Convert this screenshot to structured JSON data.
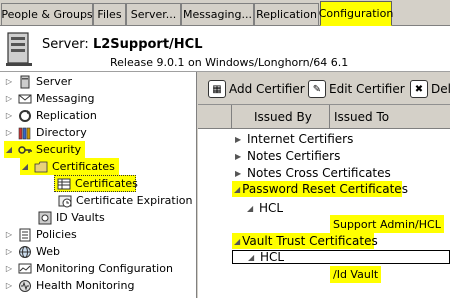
{
  "tabs": [
    {
      "label": "People & Groups",
      "active": false
    },
    {
      "label": "Files",
      "active": false
    },
    {
      "label": "Server...",
      "active": false
    },
    {
      "label": "Messaging...",
      "active": false
    },
    {
      "label": "Replication",
      "active": false
    },
    {
      "label": "Configuration",
      "active": true
    }
  ],
  "header": {
    "server_prefix": "Server:",
    "server_name": "L2Support/HCL",
    "release": "Release 9.0.1 on Windows/Longhorn/64 6.1"
  },
  "tree": {
    "items": [
      {
        "label": "Server",
        "icon": "server-icon",
        "expanded": false
      },
      {
        "label": "Messaging",
        "icon": "messaging-icon",
        "expanded": false
      },
      {
        "label": "Replication",
        "icon": "replication-icon",
        "expanded": false
      },
      {
        "label": "Directory",
        "icon": "directory-icon",
        "expanded": false
      },
      {
        "label": "Security",
        "icon": "key-icon",
        "expanded": true,
        "highlighted": true
      },
      {
        "label": "Certificates",
        "icon": "certificate-folder-icon",
        "expanded": true,
        "highlighted": true
      },
      {
        "label": "Certificates",
        "icon": "certificate-view-icon",
        "selected": true,
        "highlighted": true
      },
      {
        "label": "Certificate Expiration",
        "icon": "certificate-expiration-icon"
      },
      {
        "label": "ID Vaults",
        "icon": "id-vault-icon"
      },
      {
        "label": "Policies",
        "icon": "policies-icon",
        "expanded": false
      },
      {
        "label": "Web",
        "icon": "web-icon",
        "expanded": false
      },
      {
        "label": "Monitoring Configuration",
        "icon": "monitoring-icon",
        "expanded": false
      },
      {
        "label": "Health Monitoring",
        "icon": "health-icon",
        "expanded": false
      }
    ]
  },
  "toolbar": {
    "add_label": "Add Certifier",
    "edit_label": "Edit Certifier",
    "delete_label": "Del"
  },
  "columns": {
    "issued_by": "Issued By",
    "issued_to": "Issued To"
  },
  "list": {
    "rows": [
      {
        "label": "Internet Certifiers",
        "type": "category"
      },
      {
        "label": "Notes Certifiers",
        "type": "category"
      },
      {
        "label": "Notes Cross Certificates",
        "type": "category"
      },
      {
        "label": "Password Reset Certificates",
        "type": "category",
        "expanded": true,
        "highlighted": true
      },
      {
        "label": "HCL",
        "type": "subcategory"
      },
      {
        "label": "Vault Trust Certificates",
        "type": "category",
        "expanded": true,
        "highlighted": true
      },
      {
        "label": "HCL",
        "type": "subcategory",
        "selected": true
      }
    ],
    "annotations": {
      "issued_to_password": "Support Admin/HCL",
      "issued_to_vault": "/Id Vault"
    }
  },
  "colors": {
    "highlight": "#ffff00",
    "window_bg": "#d4d0c8"
  }
}
